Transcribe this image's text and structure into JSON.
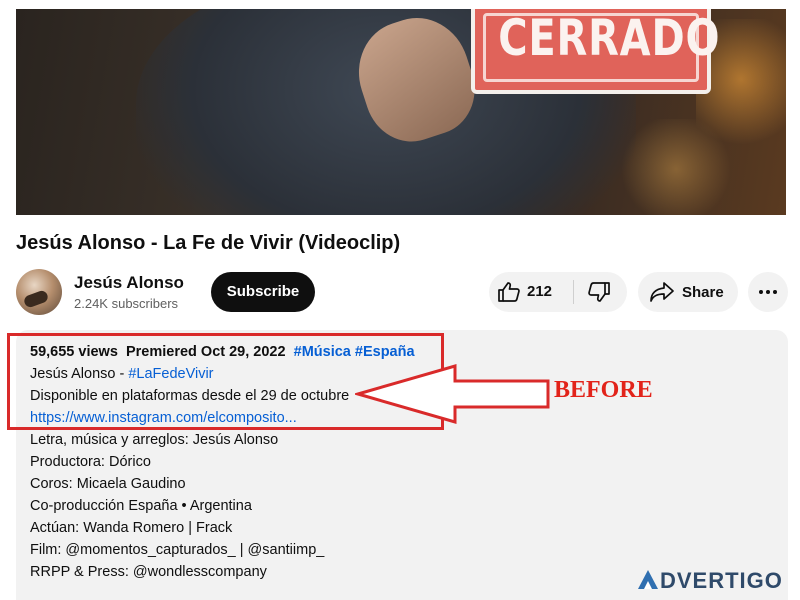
{
  "video": {
    "sign_text": "CERRADO"
  },
  "title": "Jesús Alonso - La Fe de Vivir (Videoclip)",
  "channel": {
    "name": "Jesús Alonso",
    "subscribers": "2.24K subscribers"
  },
  "actions": {
    "subscribe_label": "Subscribe",
    "like_count": "212",
    "share_label": "Share"
  },
  "description": {
    "views": "59,655 views",
    "premiered": "Premiered Oct 29, 2022",
    "tags": [
      "#Música",
      "#España"
    ],
    "line1_prefix": "Jesús Alonso - ",
    "line1_tag": "#LaFedeVivir",
    "line2": "Disponible en plataformas desde el 29 de octubre",
    "link": "https://www.instagram.com/elcomposito...",
    "credits": [
      "Letra, música y arreglos: Jesús Alonso",
      "Productora: Dórico",
      "Coros: Micaela Gaudino",
      "Co-producción España • Argentina",
      "Actúan: Wanda Romero | Frack",
      "Film: @momentos_capturados_ | @santiimp_",
      "RRPP & Press: @wondlesscompany"
    ]
  },
  "annotation": {
    "label": "BEFORE",
    "color": "#e2231a"
  },
  "watermark": {
    "text": "DVERTIGO"
  }
}
